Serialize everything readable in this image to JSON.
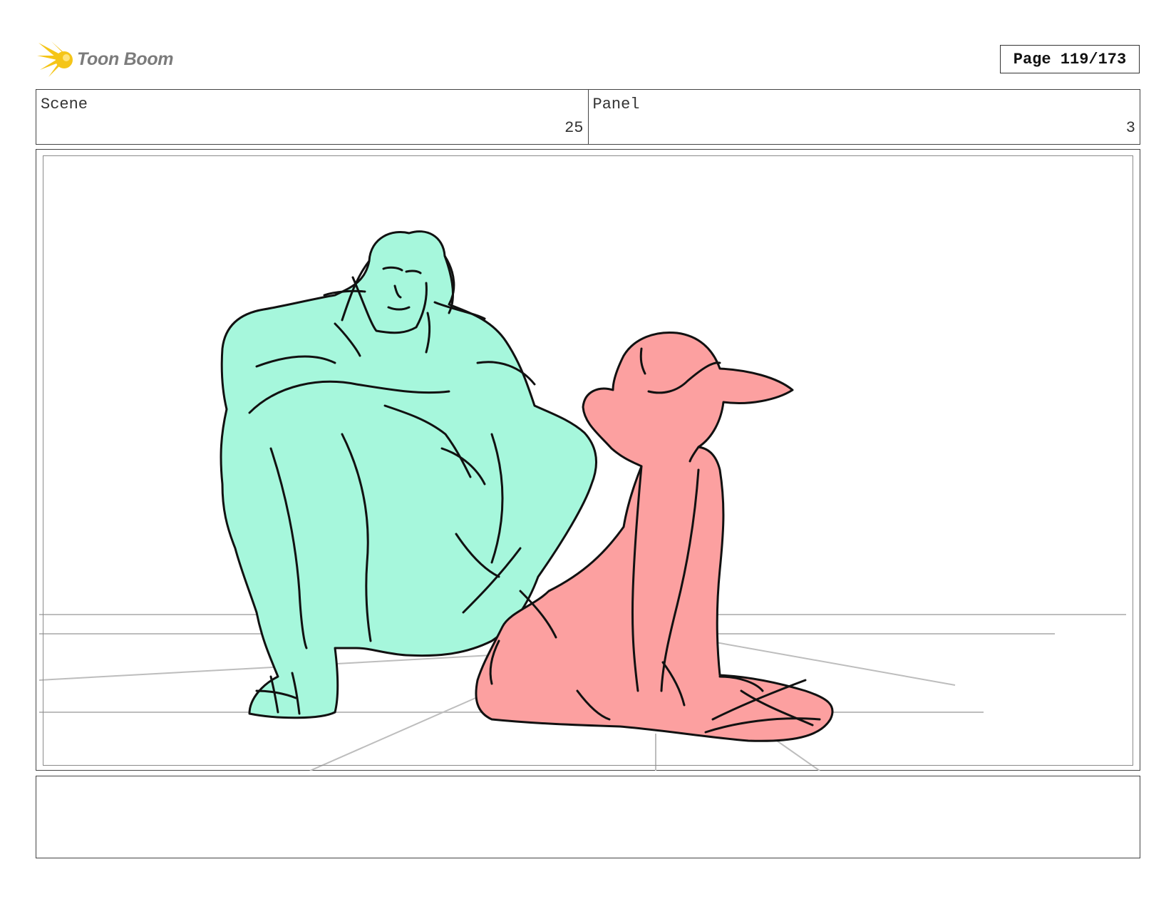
{
  "header": {
    "logo_text": "Toon Boom",
    "page_label": "Page 119/173"
  },
  "info": {
    "scene_label": "Scene",
    "scene_value": "25",
    "panel_label": "Panel",
    "panel_value": "3"
  },
  "colors": {
    "teal_fill": "#a6f7dc",
    "pink_fill": "#fca0a0",
    "logo_yellow": "#f5c518",
    "ink": "#111111",
    "floor_lines": "#bdbdbd"
  },
  "notes": {
    "text": ""
  }
}
